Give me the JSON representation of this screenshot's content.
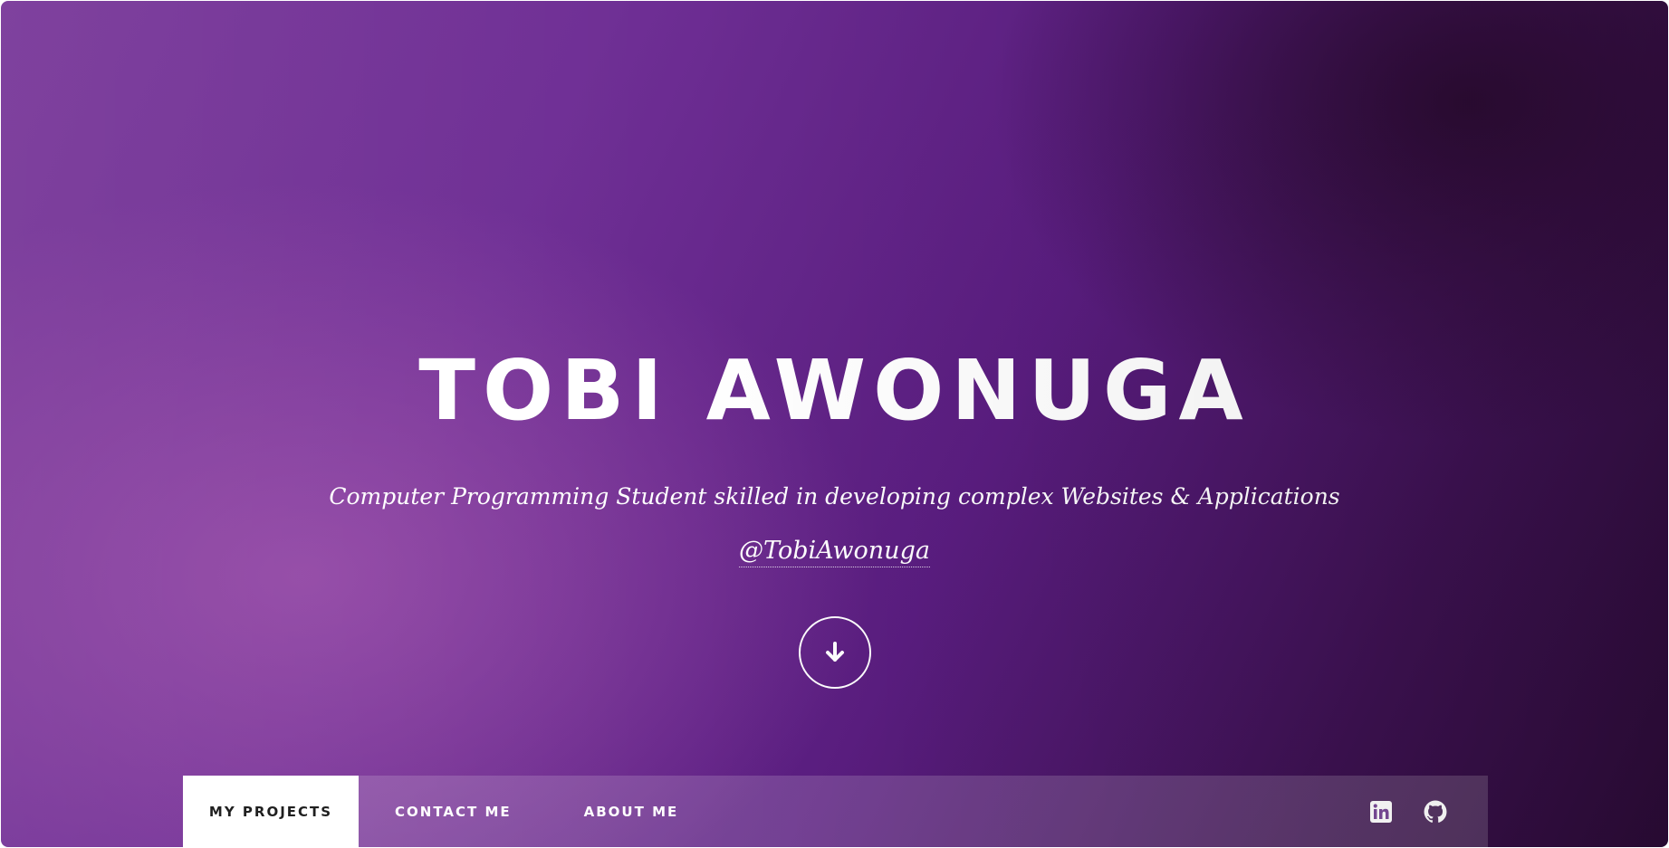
{
  "hero": {
    "name": "TOBI AWONUGA",
    "tagline": "Computer Programming Student skilled in developing complex Websites & Applications",
    "handle": "@TobiAwonuga",
    "scroll_icon": "arrow-down-icon"
  },
  "nav": {
    "tabs": [
      {
        "label": "MY PROJECTS",
        "active": true
      },
      {
        "label": "CONTACT ME",
        "active": false
      },
      {
        "label": "ABOUT ME",
        "active": false
      }
    ],
    "icons": [
      "linkedin-icon",
      "github-icon"
    ]
  },
  "colors": {
    "accent": "#6a2a90",
    "text": "#ffffff",
    "active_tab_bg": "#ffffff",
    "active_tab_text": "#1a1a1a"
  }
}
